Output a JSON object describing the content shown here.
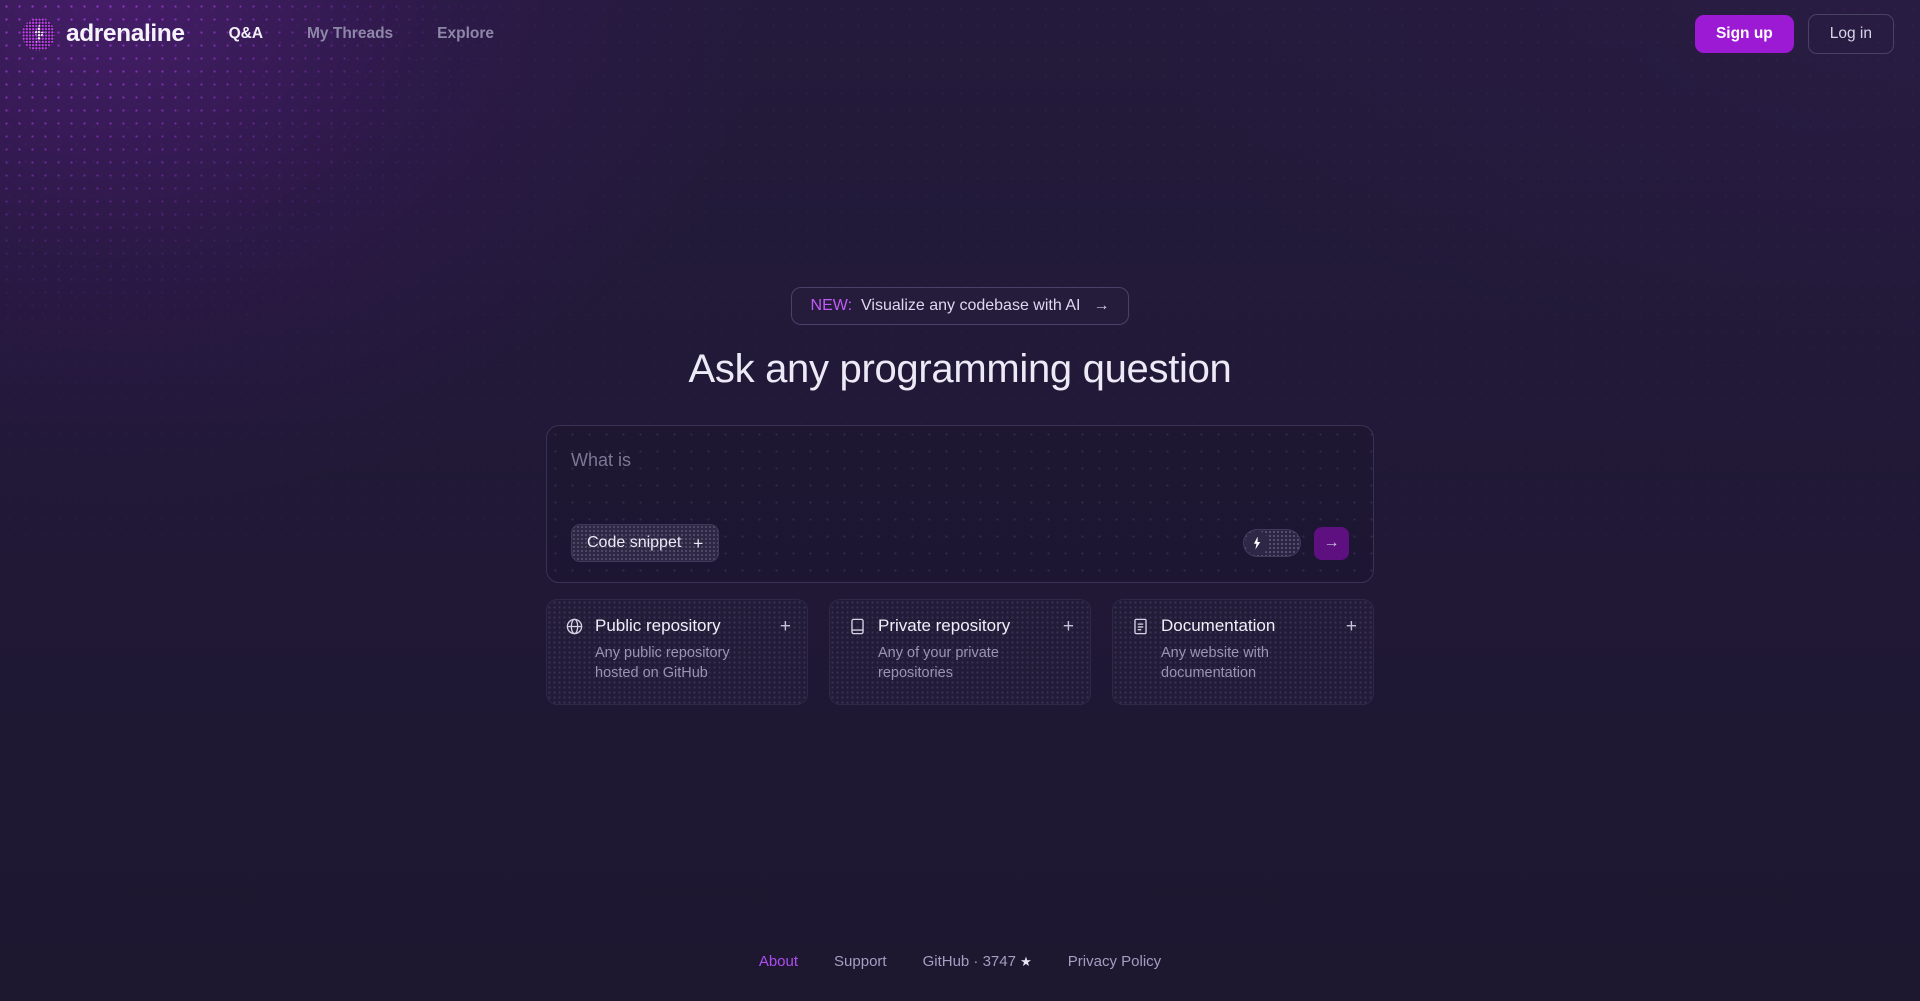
{
  "brand": {
    "name": "adrenaline",
    "logo_icon": "dotted-sphere-bolt-icon"
  },
  "nav": {
    "items": [
      {
        "label": "Q&A",
        "active": true
      },
      {
        "label": "My Threads",
        "active": false
      },
      {
        "label": "Explore",
        "active": false
      }
    ]
  },
  "header_actions": {
    "signup_label": "Sign up",
    "login_label": "Log in"
  },
  "announcement": {
    "tag": "NEW:",
    "text": "Visualize any codebase with AI",
    "arrow": "→"
  },
  "hero": {
    "title": "Ask any programming question"
  },
  "composer": {
    "placeholder": "What is",
    "value": "",
    "code_snippet_label": "Code snippet",
    "code_snippet_plus": "+",
    "toggle_icon": "lightning-bolt-icon",
    "toggle_state": "off",
    "send_icon": "→"
  },
  "sources": {
    "cards": [
      {
        "icon": "globe-icon",
        "title": "Public repository",
        "description": "Any public repository hosted on GitHub",
        "plus": "+"
      },
      {
        "icon": "book-lock-icon",
        "title": "Private repository",
        "description": "Any of your private repositories",
        "plus": "+"
      },
      {
        "icon": "document-text-icon",
        "title": "Documentation",
        "description": "Any website with documentation",
        "plus": "+"
      }
    ]
  },
  "footer": {
    "links": [
      {
        "label": "About",
        "accent": true
      },
      {
        "label": "Support",
        "accent": false
      },
      {
        "label": "GitHub · 3747",
        "accent": false,
        "star": "★"
      },
      {
        "label": "Privacy Policy",
        "accent": false
      }
    ]
  },
  "colors": {
    "page_background": "#211937",
    "accent_purple": "#9c1ad4",
    "accent_light_purple": "#c05cf5",
    "send_button": "#5e1080",
    "text_primary": "#eceaf6",
    "text_muted": "#8e87a8"
  }
}
